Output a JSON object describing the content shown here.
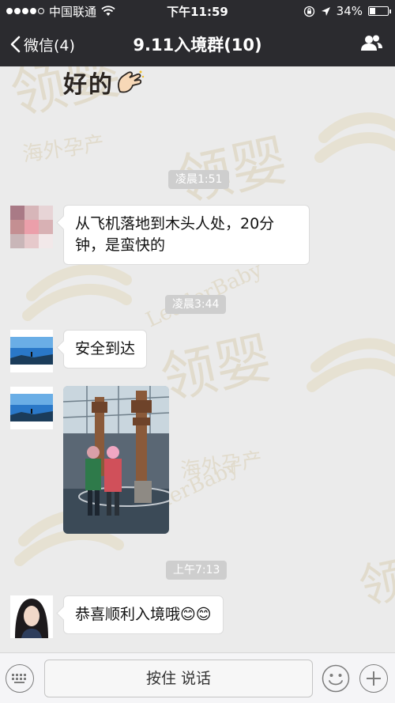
{
  "status_bar": {
    "carrier": "中国联通",
    "time": "下午11:59",
    "battery": "34%",
    "battery_level": 0.34,
    "signal_bars": 4
  },
  "nav": {
    "back_label": "微信(4)",
    "title": "9.11入境群(10)"
  },
  "sticker": {
    "text": "好的"
  },
  "messages": [
    {
      "type": "time",
      "text": "凌晨1:51"
    },
    {
      "type": "text",
      "line1": "从飞机落地到木头人处，20分",
      "line2": "钟，是蛮快的"
    },
    {
      "type": "time",
      "text": "凌晨3:44"
    },
    {
      "type": "text",
      "text": "安全到达"
    },
    {
      "type": "image"
    },
    {
      "type": "time",
      "text": "上午7:13"
    },
    {
      "type": "text",
      "text": "恭喜顺利入境哦😊😊"
    }
  ],
  "watermark": {
    "brand_cn": "领婴",
    "brand_en": "LeaderBaby",
    "subtitle": "海外孕产"
  },
  "input_bar": {
    "talk_label": "按住 说话"
  },
  "icons": {
    "keyboard": "keyboard-icon",
    "emoji": "emoji-icon",
    "plus": "plus-icon",
    "group": "group-icon",
    "back": "chevron-left-icon"
  },
  "colors": {
    "nav_bg": "#2b2b2f",
    "chat_bg": "#ebebeb",
    "bubble": "#ffffff",
    "time_label_bg": "#cecece"
  }
}
